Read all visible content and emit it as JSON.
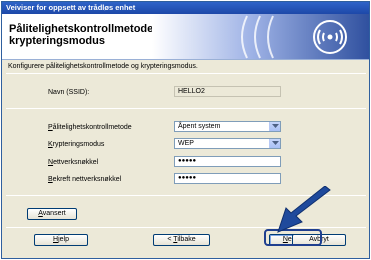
{
  "window": {
    "title": "Veiviser for oppsett av trådløs enhet"
  },
  "header": {
    "title_line1": "Pålitelighetskontrollmetode og",
    "title_line2": "krypteringsmodus"
  },
  "subtitle": "Konfigurere pålitelighetskontrollmetode og krypteringsmodus.",
  "ssid": {
    "label": "Navn (SSID):",
    "value": "HELLO2"
  },
  "auth": {
    "label_first": "P",
    "label_rest": "ålitelighetskontrollmetode",
    "value": "Åpent system"
  },
  "encryption": {
    "label_first": "K",
    "label_rest": "rypteringsmodus",
    "value": "WEP"
  },
  "network_key": {
    "label_first": "N",
    "label_rest": "ettverksnøkkel",
    "value": "●●●●●"
  },
  "confirm_key": {
    "label_first": "B",
    "label_rest": "ekreft nettverksnøkkel",
    "value": "●●●●●"
  },
  "buttons": {
    "advanced_first": "A",
    "advanced_rest": "vansert",
    "help_first": "H",
    "help_rest": "jelp",
    "back_prefix": "< ",
    "back_first": "T",
    "back_rest": "ilbake",
    "next_first": "N",
    "next_rest": "este >",
    "cancel": "Avbryt"
  },
  "colors": {
    "accent": "#1d48a8",
    "arrow": "#1f4a9c",
    "panel": "#ece9d8"
  }
}
